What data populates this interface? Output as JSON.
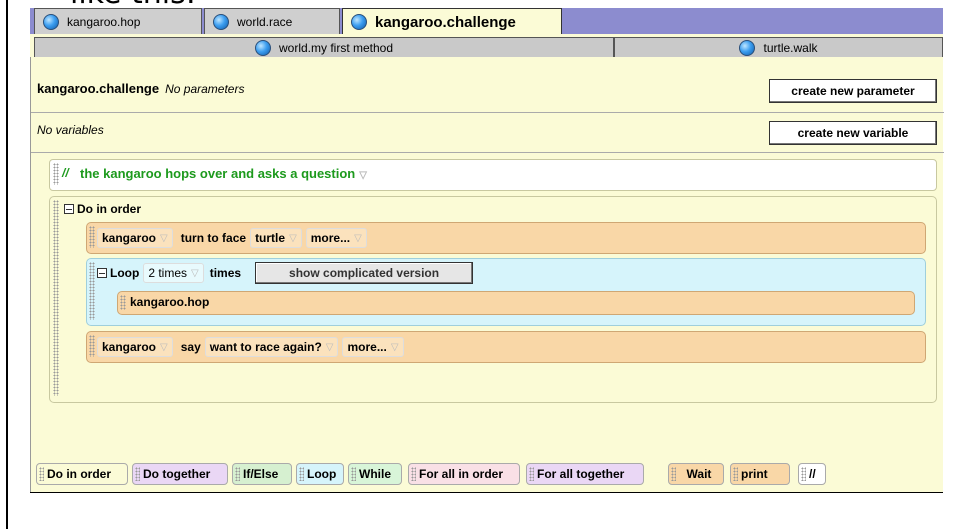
{
  "top_note": "like this:",
  "tabs_top": [
    {
      "label": "kangaroo.hop"
    },
    {
      "label": "world.race"
    },
    {
      "label": "kangaroo.challenge"
    }
  ],
  "tabs_bottom": [
    {
      "label": "world.my first method"
    },
    {
      "label": "turtle.walk"
    }
  ],
  "method": {
    "name": "kangaroo.challenge",
    "params": "No parameters",
    "variables": "No variables",
    "create_param_btn": "create new parameter",
    "create_var_btn": "create new variable"
  },
  "comment": {
    "slashes": "//",
    "text": "the kangaroo hops over and asks a question"
  },
  "do_in_order": {
    "label": "Do in order",
    "stmt1": {
      "object": "kangaroo",
      "action": "turn to face",
      "target": "turtle",
      "more": "more..."
    },
    "loop": {
      "label": "Loop",
      "count": "2 times",
      "times": "times",
      "complicated_btn": "show complicated version",
      "inner": "kangaroo.hop"
    },
    "stmt3": {
      "object": "kangaroo",
      "action": "say",
      "text": "want to race again?",
      "more": "more..."
    }
  },
  "palette": [
    {
      "label": "Do in order",
      "color": "#fbfbd6"
    },
    {
      "label": "Do together",
      "color": "#ead7f5"
    },
    {
      "label": "If/Else",
      "color": "#d6f0d0"
    },
    {
      "label": "Loop",
      "color": "#d6f4fb"
    },
    {
      "label": "While",
      "color": "#d8f5d8"
    },
    {
      "label": "For all in order",
      "color": "#f9e0e6"
    },
    {
      "label": "For all together",
      "color": "#ead7f5"
    },
    {
      "label": "Wait",
      "color": "#f9d7a7"
    },
    {
      "label": "print",
      "color": "#f9d7a7"
    },
    {
      "label": "//",
      "color": "#ffffff"
    }
  ]
}
